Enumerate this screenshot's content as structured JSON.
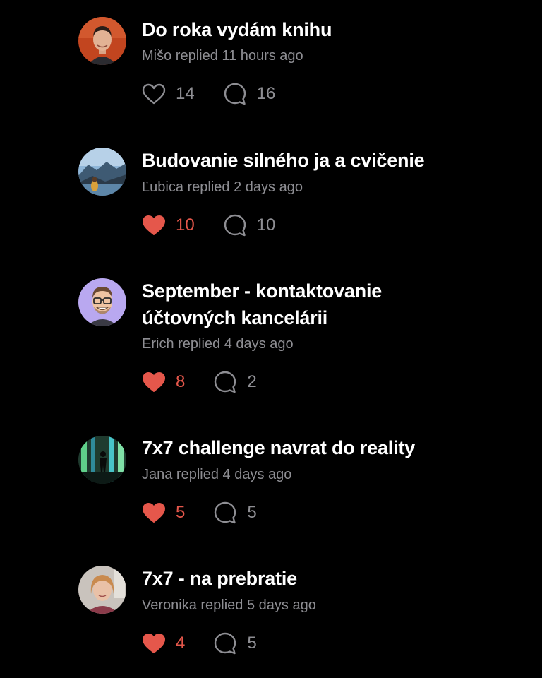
{
  "colors": {
    "background": "#000000",
    "title": "#ffffff",
    "muted": "#8e8e93",
    "liked": "#e5574b"
  },
  "threads": [
    {
      "title": "Do roka vydám knihu",
      "meta": "Mišo replied 11 hours ago",
      "likes": "14",
      "comments": "16",
      "liked": false,
      "avatar_icon": "man-portrait-avatar"
    },
    {
      "title": "Budovanie silného ja a cvičenie",
      "meta": "Ľubica replied 2 days ago",
      "likes": "10",
      "comments": "10",
      "liked": true,
      "avatar_icon": "landscape-avatar"
    },
    {
      "title": "September - kontaktovanie\núčtovných kancelárii",
      "meta": "Erich replied 4 days ago",
      "likes": "8",
      "comments": "2",
      "liked": true,
      "avatar_icon": "illustrated-man-avatar"
    },
    {
      "title": "7x7 challenge navrat do reality",
      "meta": "Jana replied 4 days ago",
      "likes": "5",
      "comments": "5",
      "liked": true,
      "avatar_icon": "forest-silhouette-avatar"
    },
    {
      "title": "7x7 - na prebratie",
      "meta": "Veronika replied 5 days ago",
      "likes": "4",
      "comments": "5",
      "liked": true,
      "avatar_icon": "woman-portrait-avatar"
    }
  ]
}
